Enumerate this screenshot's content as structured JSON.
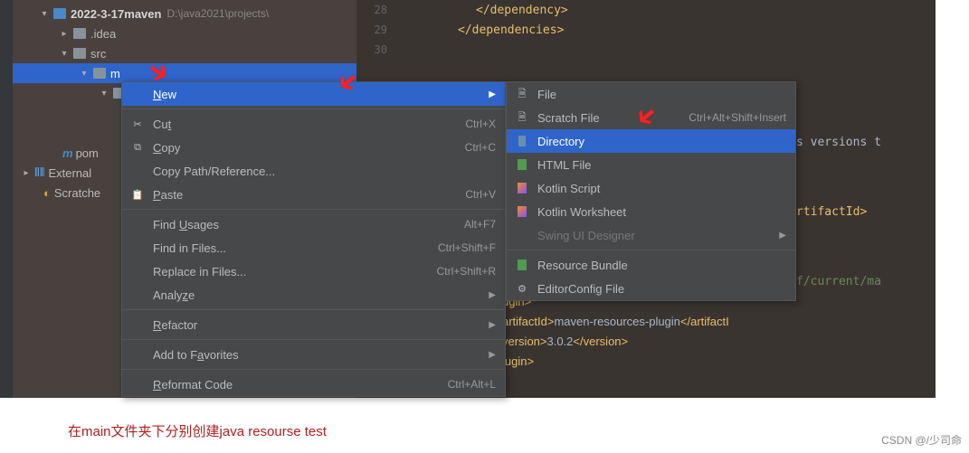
{
  "tree": {
    "project": "2022-3-17maven",
    "path": "D:\\java2021\\projects\\",
    "idea": ".idea",
    "src": "src",
    "main": "m",
    "pom": "pom",
    "external": "External",
    "scratches": "Scratche"
  },
  "editor": {
    "l28": {
      "no": "28",
      "code": "</dependency>"
    },
    "l29": {
      "no": "29",
      "code": "</dependencies>"
    },
    "l30": {
      "no": "30"
    },
    "frag1": "s versions t",
    "frag2": "rtifactId>",
    "frag3": "f/current/ma",
    "frag4a": "ugin>",
    "frag4b": "artifactId>",
    "frag4c": "maven-resources-plugin",
    "frag4d": "</artifactI",
    "frag5a": "version>",
    "frag5b": "3.0.2",
    "frag5c": "</version>",
    "frag6": "lugin>"
  },
  "menu1": {
    "new": "New",
    "cut": "Cut",
    "cut_sc": "Ctrl+X",
    "copy": "Copy",
    "copy_sc": "Ctrl+C",
    "copypath": "Copy Path/Reference...",
    "paste": "Paste",
    "paste_sc": "Ctrl+V",
    "findusages": "Find Usages",
    "findusages_sc": "Alt+F7",
    "findfiles": "Find in Files...",
    "findfiles_sc": "Ctrl+Shift+F",
    "replace": "Replace in Files...",
    "replace_sc": "Ctrl+Shift+R",
    "analyze": "Analyze",
    "refactor": "Refactor",
    "fav": "Add to Favorites",
    "reformat": "Reformat Code",
    "reformat_sc": "Ctrl+Alt+L"
  },
  "menu2": {
    "file": "File",
    "scratch": "Scratch File",
    "scratch_sc": "Ctrl+Alt+Shift+Insert",
    "directory": "Directory",
    "html": "HTML File",
    "kotlin": "Kotlin Script",
    "kotlinws": "Kotlin Worksheet",
    "swing": "Swing UI Designer",
    "resource": "Resource Bundle",
    "editorconfig": "EditorConfig File"
  },
  "caption": "在main文件夹下分别创建java resourse test",
  "watermark": "CSDN @/少司命"
}
